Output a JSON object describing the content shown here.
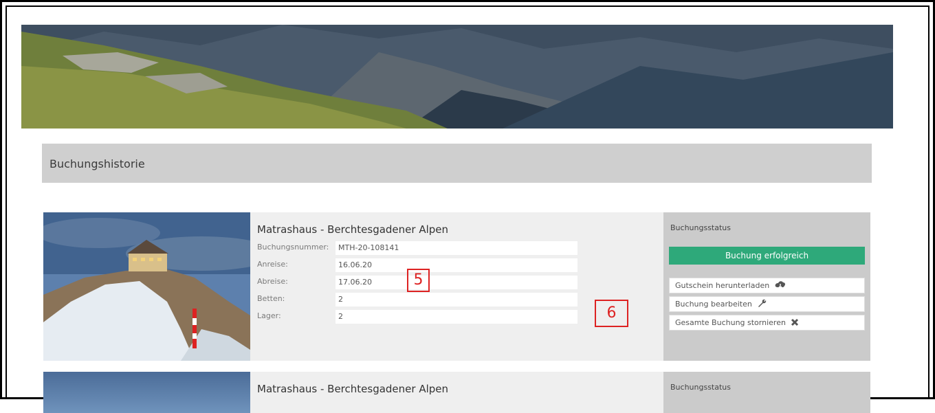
{
  "page": {
    "section_title": "Buchungshistorie"
  },
  "bookings": [
    {
      "hut_name": "Matrashaus - Berchtesgadener Alpen",
      "fields": [
        {
          "label": "Buchungsnummer:",
          "value": "MTH-20-108141"
        },
        {
          "label": "Anreise:",
          "value": "16.06.20"
        },
        {
          "label": "Abreise:",
          "value": "17.06.20"
        },
        {
          "label": "Betten:",
          "value": "2"
        },
        {
          "label": "Lager:",
          "value": "2"
        }
      ],
      "status_title": "Buchungsstatus",
      "status_badge": "Buchung erfolgreich",
      "actions": [
        {
          "label": "Gutschein herunterladen",
          "icon": "cloud-download-icon"
        },
        {
          "label": "Buchung bearbeiten",
          "icon": "wrench-icon"
        },
        {
          "label": "Gesamte Buchung stornieren",
          "icon": "close-icon"
        }
      ]
    },
    {
      "hut_name": "Matrashaus - Berchtesgadener Alpen",
      "status_title": "Buchungsstatus"
    }
  ],
  "annotations": [
    "5",
    "6"
  ],
  "colors": {
    "success": "#2ea97a",
    "panel": "#cfcfcf",
    "annotation": "#dd2222"
  }
}
